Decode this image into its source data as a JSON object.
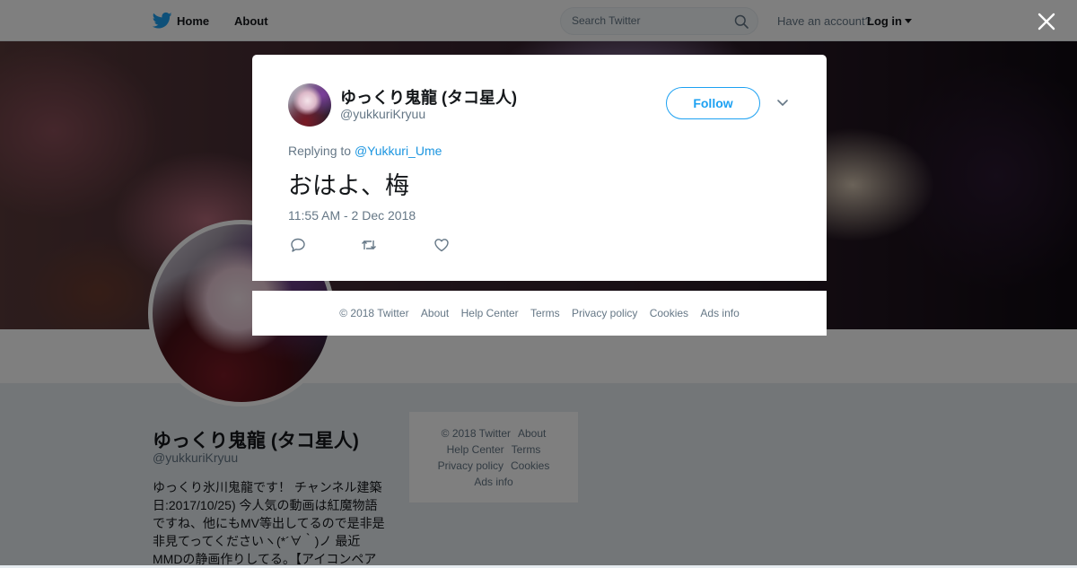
{
  "topbar": {
    "home_label": "Home",
    "about_label": "About",
    "search_placeholder": "Search Twitter",
    "account_prompt": "Have an account?",
    "login_label": "Log in"
  },
  "profile": {
    "name": "ゆっくり鬼龍 (タコ星人)",
    "handle": "@yukkuriKryuu",
    "bio": "ゆっくり氷川鬼龍です！ チャンネル建築日:2017/10/25) 今人気の動画は紅魔物語ですね、他にもMV等出してるので是非是非見てってくださいヽ(*´∀｀)ノ 最近MMDの静画作りしてる。【アイコンペア"
  },
  "side_footer": {
    "copyright": "© 2018 Twitter",
    "about": "About",
    "help_center": "Help Center",
    "terms": "Terms",
    "privacy": "Privacy policy",
    "cookies": "Cookies",
    "ads_info": "Ads info"
  },
  "tweet": {
    "author_name": "ゆっくり鬼龍 (タコ星人)",
    "author_handle": "@yukkuriKryuu",
    "follow_label": "Follow",
    "replying_to_prefix": "Replying to",
    "replying_to_handle": "@Yukkuri_Ume",
    "text": "おはよ、梅",
    "timestamp": "11:55 AM - 2 Dec 2018",
    "icons": [
      "reply-icon",
      "retweet-icon",
      "like-icon",
      "chevron-down-icon"
    ]
  },
  "modal_footer": {
    "copyright": "© 2018 Twitter",
    "about": "About",
    "help_center": "Help Center",
    "terms": "Terms",
    "privacy": "Privacy policy",
    "cookies": "Cookies",
    "ads_info": "Ads info"
  },
  "colors": {
    "accent": "#1da1f2",
    "link": "#1b95e0",
    "text": "#14171a",
    "muted": "#657786",
    "page_bg": "#e6ecf0"
  }
}
